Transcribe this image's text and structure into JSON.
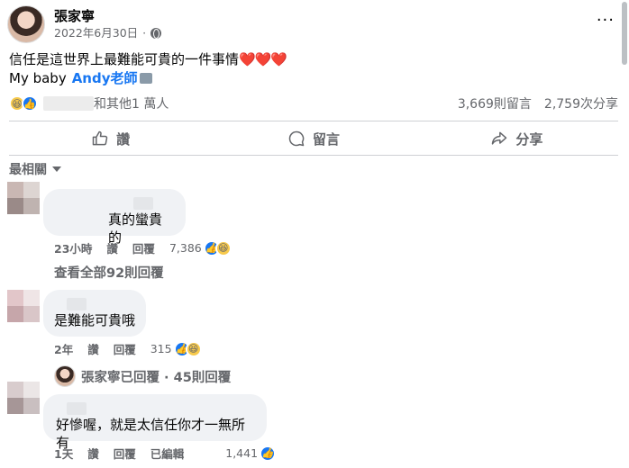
{
  "post": {
    "author": "張家寧",
    "date": "2022年6月30日",
    "more": "···",
    "text_line1": "信任是這世界上最難能可貴的一件事情",
    "hearts": "❤️❤️❤️",
    "text_line2_prefix": "My baby",
    "mention": "Andy老師",
    "reaction_names": "和其他1 萬人",
    "comments_count": "3,669則留言",
    "shares_count": "2,759次分享"
  },
  "actions": {
    "like": "讚",
    "comment": "留言",
    "share": "分享"
  },
  "sort_label": "最相關",
  "comments": [
    {
      "text": "真的蠻貴的",
      "time": "23小時",
      "like": "讚",
      "reply": "回覆",
      "reactions": "7,386",
      "view_replies": "查看全部92則回覆"
    },
    {
      "text": "是難能可貴哦",
      "time": "2年",
      "like": "讚",
      "reply": "回覆",
      "reactions": "315",
      "reply_summary": "張家寧已回覆 · 45則回覆"
    },
    {
      "text": "好慘喔，就是太信任你才一無所有",
      "time": "1天",
      "like": "讚",
      "reply": "回覆",
      "edited": "已編輯",
      "reactions": "1,441"
    }
  ],
  "colors": {
    "accent": "#1877f2",
    "muted": "#65676b",
    "bubble": "#f0f2f5"
  },
  "icons": [
    "globe-icon",
    "more-icon",
    "haha-reaction-icon",
    "like-reaction-icon",
    "thumbs-up-icon",
    "comment-icon",
    "share-icon",
    "caret-down-icon"
  ]
}
